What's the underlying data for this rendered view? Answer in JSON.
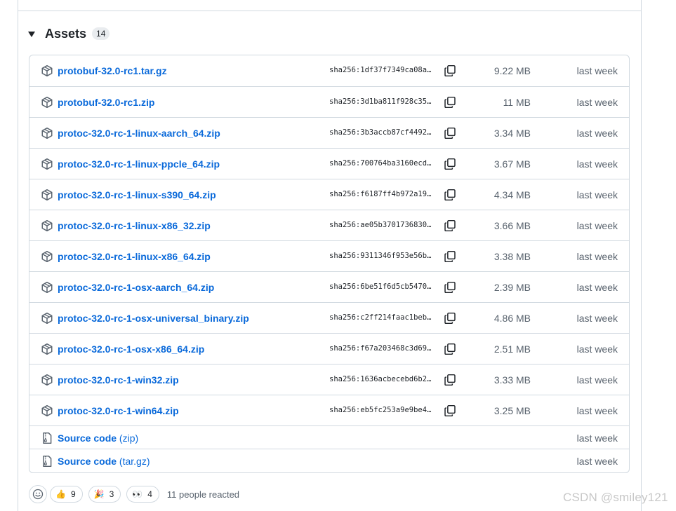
{
  "assets": {
    "title": "Assets",
    "count": "14",
    "files": [
      {
        "name": "protobuf-32.0-rc1.tar.gz",
        "hash": "sha256:1df37f7349ca08a…",
        "size": "9.22 MB",
        "date": "last week"
      },
      {
        "name": "protobuf-32.0-rc1.zip",
        "hash": "sha256:3d1ba811f928c35…",
        "size": "11 MB",
        "date": "last week"
      },
      {
        "name": "protoc-32.0-rc-1-linux-aarch_64.zip",
        "hash": "sha256:3b3accb87cf4492…",
        "size": "3.34 MB",
        "date": "last week"
      },
      {
        "name": "protoc-32.0-rc-1-linux-ppcle_64.zip",
        "hash": "sha256:700764ba3160ecd…",
        "size": "3.67 MB",
        "date": "last week"
      },
      {
        "name": "protoc-32.0-rc-1-linux-s390_64.zip",
        "hash": "sha256:f6187ff4b972a19…",
        "size": "4.34 MB",
        "date": "last week"
      },
      {
        "name": "protoc-32.0-rc-1-linux-x86_32.zip",
        "hash": "sha256:ae05b3701736830…",
        "size": "3.66 MB",
        "date": "last week"
      },
      {
        "name": "protoc-32.0-rc-1-linux-x86_64.zip",
        "hash": "sha256:9311346f953e56b…",
        "size": "3.38 MB",
        "date": "last week"
      },
      {
        "name": "protoc-32.0-rc-1-osx-aarch_64.zip",
        "hash": "sha256:6be51f6d5cb5470…",
        "size": "2.39 MB",
        "date": "last week"
      },
      {
        "name": "protoc-32.0-rc-1-osx-universal_binary.zip",
        "hash": "sha256:c2ff214faac1beb…",
        "size": "4.86 MB",
        "date": "last week"
      },
      {
        "name": "protoc-32.0-rc-1-osx-x86_64.zip",
        "hash": "sha256:f67a203468c3d69…",
        "size": "2.51 MB",
        "date": "last week"
      },
      {
        "name": "protoc-32.0-rc-1-win32.zip",
        "hash": "sha256:1636acbecebd6b2…",
        "size": "3.33 MB",
        "date": "last week"
      },
      {
        "name": "protoc-32.0-rc-1-win64.zip",
        "hash": "sha256:eb5fc253a9e9be4…",
        "size": "3.25 MB",
        "date": "last week"
      }
    ],
    "source": [
      {
        "name": "Source code",
        "suffix": "(zip)",
        "date": "last week"
      },
      {
        "name": "Source code",
        "suffix": "(tar.gz)",
        "date": "last week"
      }
    ]
  },
  "reactions": {
    "items": [
      {
        "emoji": "👍",
        "count": "9"
      },
      {
        "emoji": "🎉",
        "count": "3"
      },
      {
        "emoji": "👀",
        "count": "4"
      }
    ],
    "summary": "11 people reacted"
  },
  "watermark": "CSDN @smiley121",
  "colors": {
    "link": "#0969da",
    "border": "#d1d9e0",
    "muted": "#59636e"
  }
}
